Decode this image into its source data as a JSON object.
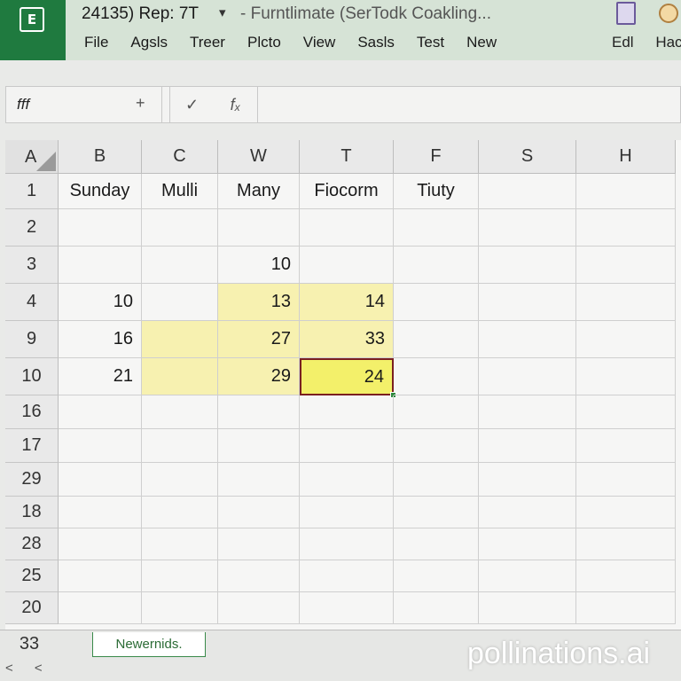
{
  "titlebar": {
    "quick_access": "24135) Rep: 7T",
    "qat_arrow": "▾",
    "document_title": "- Furntlimate (SerTodk Coakling...",
    "menu": [
      "File",
      "Agsls",
      "Treer",
      "Plcto",
      "View",
      "Sasls",
      "Test",
      "New"
    ],
    "menu_right": [
      "Edl",
      "Hac"
    ]
  },
  "formula_bar": {
    "name_box": "fff",
    "plus": "+",
    "check": "✓",
    "fx": "fₓ",
    "formula_value": ""
  },
  "grid": {
    "corner_label": "A",
    "columns": [
      "B",
      "C",
      "W",
      "T",
      "F",
      "S",
      "H"
    ],
    "rows": [
      {
        "label": "1",
        "cells": [
          "Sunday",
          "Mulli",
          "Many",
          "Fiocorm",
          "Tiuty",
          "",
          ""
        ]
      },
      {
        "label": "2",
        "cells": [
          "",
          "",
          "",
          "",
          "",
          "",
          ""
        ]
      },
      {
        "label": "3",
        "cells": [
          "",
          "",
          "10",
          "",
          "",
          "",
          ""
        ]
      },
      {
        "label": "4",
        "cells": [
          "10",
          "",
          "13",
          "14",
          "",
          "",
          ""
        ]
      },
      {
        "label": "9",
        "cells": [
          "16",
          "",
          "27",
          "33",
          "",
          "",
          ""
        ]
      },
      {
        "label": "10",
        "cells": [
          "21",
          "",
          "29",
          "24",
          "",
          "",
          ""
        ]
      },
      {
        "label": "16",
        "cells": [
          "",
          "",
          "",
          "",
          "",
          "",
          ""
        ]
      },
      {
        "label": "17",
        "cells": [
          "",
          "",
          "",
          "",
          "",
          "",
          ""
        ]
      },
      {
        "label": "29",
        "cells": [
          "",
          "",
          "",
          "",
          "",
          "",
          ""
        ]
      },
      {
        "label": "18",
        "cells": [
          "",
          "",
          "",
          "",
          "",
          "",
          ""
        ]
      },
      {
        "label": "28",
        "cells": [
          "",
          "",
          "",
          "",
          "",
          "",
          ""
        ]
      },
      {
        "label": "25",
        "cells": [
          "",
          "",
          "",
          "",
          "",
          "",
          ""
        ]
      },
      {
        "label": "20",
        "cells": [
          "",
          "",
          "",
          "",
          "",
          "",
          ""
        ]
      }
    ],
    "highlighted": [
      [
        3,
        2
      ],
      [
        3,
        3
      ],
      [
        4,
        1
      ],
      [
        4,
        2
      ],
      [
        4,
        3
      ],
      [
        5,
        1
      ],
      [
        5,
        2
      ]
    ],
    "selected": [
      5,
      3
    ]
  },
  "bottom": {
    "last_row_label": "33",
    "sheet_tab": "Newernids.",
    "nav": "< <"
  },
  "watermark": "pollinations.ai"
}
